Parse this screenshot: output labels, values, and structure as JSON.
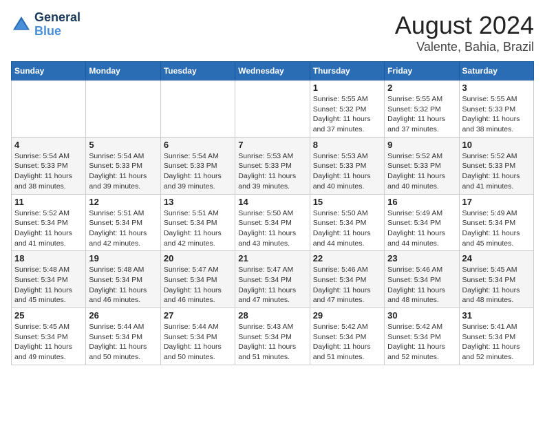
{
  "header": {
    "logo_line1": "General",
    "logo_line2": "Blue",
    "month": "August 2024",
    "location": "Valente, Bahia, Brazil"
  },
  "days_of_week": [
    "Sunday",
    "Monday",
    "Tuesday",
    "Wednesday",
    "Thursday",
    "Friday",
    "Saturday"
  ],
  "weeks": [
    [
      {
        "day": "",
        "info": ""
      },
      {
        "day": "",
        "info": ""
      },
      {
        "day": "",
        "info": ""
      },
      {
        "day": "",
        "info": ""
      },
      {
        "day": "1",
        "info": "Sunrise: 5:55 AM\nSunset: 5:32 PM\nDaylight: 11 hours\nand 37 minutes."
      },
      {
        "day": "2",
        "info": "Sunrise: 5:55 AM\nSunset: 5:32 PM\nDaylight: 11 hours\nand 37 minutes."
      },
      {
        "day": "3",
        "info": "Sunrise: 5:55 AM\nSunset: 5:33 PM\nDaylight: 11 hours\nand 38 minutes."
      }
    ],
    [
      {
        "day": "4",
        "info": "Sunrise: 5:54 AM\nSunset: 5:33 PM\nDaylight: 11 hours\nand 38 minutes."
      },
      {
        "day": "5",
        "info": "Sunrise: 5:54 AM\nSunset: 5:33 PM\nDaylight: 11 hours\nand 39 minutes."
      },
      {
        "day": "6",
        "info": "Sunrise: 5:54 AM\nSunset: 5:33 PM\nDaylight: 11 hours\nand 39 minutes."
      },
      {
        "day": "7",
        "info": "Sunrise: 5:53 AM\nSunset: 5:33 PM\nDaylight: 11 hours\nand 39 minutes."
      },
      {
        "day": "8",
        "info": "Sunrise: 5:53 AM\nSunset: 5:33 PM\nDaylight: 11 hours\nand 40 minutes."
      },
      {
        "day": "9",
        "info": "Sunrise: 5:52 AM\nSunset: 5:33 PM\nDaylight: 11 hours\nand 40 minutes."
      },
      {
        "day": "10",
        "info": "Sunrise: 5:52 AM\nSunset: 5:33 PM\nDaylight: 11 hours\nand 41 minutes."
      }
    ],
    [
      {
        "day": "11",
        "info": "Sunrise: 5:52 AM\nSunset: 5:34 PM\nDaylight: 11 hours\nand 41 minutes."
      },
      {
        "day": "12",
        "info": "Sunrise: 5:51 AM\nSunset: 5:34 PM\nDaylight: 11 hours\nand 42 minutes."
      },
      {
        "day": "13",
        "info": "Sunrise: 5:51 AM\nSunset: 5:34 PM\nDaylight: 11 hours\nand 42 minutes."
      },
      {
        "day": "14",
        "info": "Sunrise: 5:50 AM\nSunset: 5:34 PM\nDaylight: 11 hours\nand 43 minutes."
      },
      {
        "day": "15",
        "info": "Sunrise: 5:50 AM\nSunset: 5:34 PM\nDaylight: 11 hours\nand 44 minutes."
      },
      {
        "day": "16",
        "info": "Sunrise: 5:49 AM\nSunset: 5:34 PM\nDaylight: 11 hours\nand 44 minutes."
      },
      {
        "day": "17",
        "info": "Sunrise: 5:49 AM\nSunset: 5:34 PM\nDaylight: 11 hours\nand 45 minutes."
      }
    ],
    [
      {
        "day": "18",
        "info": "Sunrise: 5:48 AM\nSunset: 5:34 PM\nDaylight: 11 hours\nand 45 minutes."
      },
      {
        "day": "19",
        "info": "Sunrise: 5:48 AM\nSunset: 5:34 PM\nDaylight: 11 hours\nand 46 minutes."
      },
      {
        "day": "20",
        "info": "Sunrise: 5:47 AM\nSunset: 5:34 PM\nDaylight: 11 hours\nand 46 minutes."
      },
      {
        "day": "21",
        "info": "Sunrise: 5:47 AM\nSunset: 5:34 PM\nDaylight: 11 hours\nand 47 minutes."
      },
      {
        "day": "22",
        "info": "Sunrise: 5:46 AM\nSunset: 5:34 PM\nDaylight: 11 hours\nand 47 minutes."
      },
      {
        "day": "23",
        "info": "Sunrise: 5:46 AM\nSunset: 5:34 PM\nDaylight: 11 hours\nand 48 minutes."
      },
      {
        "day": "24",
        "info": "Sunrise: 5:45 AM\nSunset: 5:34 PM\nDaylight: 11 hours\nand 48 minutes."
      }
    ],
    [
      {
        "day": "25",
        "info": "Sunrise: 5:45 AM\nSunset: 5:34 PM\nDaylight: 11 hours\nand 49 minutes."
      },
      {
        "day": "26",
        "info": "Sunrise: 5:44 AM\nSunset: 5:34 PM\nDaylight: 11 hours\nand 50 minutes."
      },
      {
        "day": "27",
        "info": "Sunrise: 5:44 AM\nSunset: 5:34 PM\nDaylight: 11 hours\nand 50 minutes."
      },
      {
        "day": "28",
        "info": "Sunrise: 5:43 AM\nSunset: 5:34 PM\nDaylight: 11 hours\nand 51 minutes."
      },
      {
        "day": "29",
        "info": "Sunrise: 5:42 AM\nSunset: 5:34 PM\nDaylight: 11 hours\nand 51 minutes."
      },
      {
        "day": "30",
        "info": "Sunrise: 5:42 AM\nSunset: 5:34 PM\nDaylight: 11 hours\nand 52 minutes."
      },
      {
        "day": "31",
        "info": "Sunrise: 5:41 AM\nSunset: 5:34 PM\nDaylight: 11 hours\nand 52 minutes."
      }
    ]
  ]
}
